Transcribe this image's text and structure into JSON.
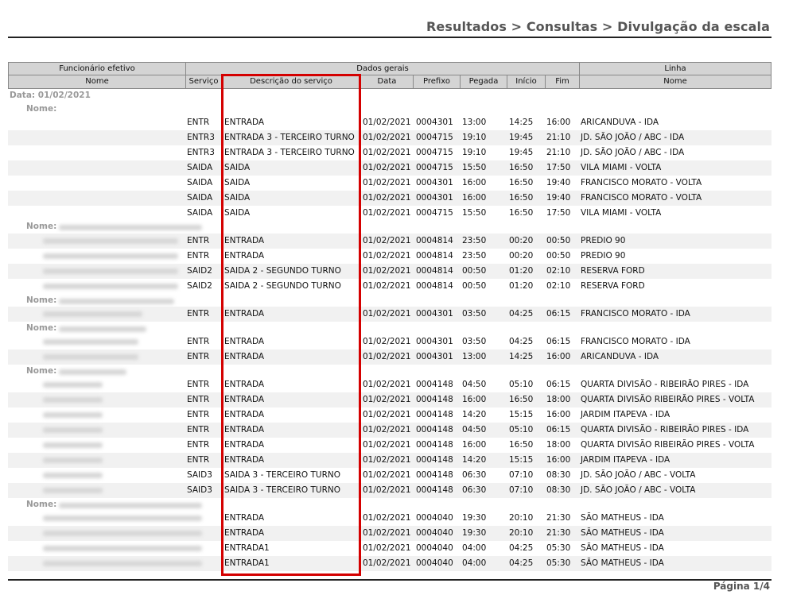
{
  "title": "Resultados > Consultas > Divulgação da escala",
  "footer": "Página 1/4",
  "headers": {
    "group1": "Funcionário efetivo",
    "group2": "Dados gerais",
    "group3": "Linha",
    "nome": "Nome",
    "servico": "Serviço",
    "descricao": "Descrição do serviço",
    "data": "Data",
    "prefixo": "Prefixo",
    "pegada": "Pegada",
    "inicio": "Início",
    "fim": "Fim",
    "linha_nome": "Nome"
  },
  "date_label": "Data: 01/02/2021",
  "nome_label": "Nome:",
  "rows": [
    {
      "srv": "ENTR",
      "desc": "ENTRADA",
      "data": "01/02/2021",
      "pref": "0004301",
      "peg": "13:00",
      "ini": "14:25",
      "fim": "16:00",
      "linha": "ARICANDUVA - IDA"
    },
    {
      "srv": "ENTR3",
      "desc": "ENTRADA 3 - TERCEIRO TURNO",
      "data": "01/02/2021",
      "pref": "0004715",
      "peg": "19:10",
      "ini": "19:45",
      "fim": "21:10",
      "linha": "JD. SÃO JOÃO / ABC - IDA"
    },
    {
      "srv": "ENTR3",
      "desc": "ENTRADA 3 - TERCEIRO TURNO",
      "data": "01/02/2021",
      "pref": "0004715",
      "peg": "19:10",
      "ini": "19:45",
      "fim": "21:10",
      "linha": "JD. SÃO JOÃO / ABC - IDA"
    },
    {
      "srv": "SAIDA",
      "desc": "SAIDA",
      "data": "01/02/2021",
      "pref": "0004715",
      "peg": "15:50",
      "ini": "16:50",
      "fim": "17:50",
      "linha": "VILA MIAMI - VOLTA"
    },
    {
      "srv": "SAIDA",
      "desc": "SAIDA",
      "data": "01/02/2021",
      "pref": "0004301",
      "peg": "16:00",
      "ini": "16:50",
      "fim": "19:40",
      "linha": "FRANCISCO MORATO - VOLTA"
    },
    {
      "srv": "SAIDA",
      "desc": "SAIDA",
      "data": "01/02/2021",
      "pref": "0004301",
      "peg": "16:00",
      "ini": "16:50",
      "fim": "19:40",
      "linha": "FRANCISCO MORATO - VOLTA"
    },
    {
      "srv": "SAIDA",
      "desc": "SAIDA",
      "data": "01/02/2021",
      "pref": "0004715",
      "peg": "15:50",
      "ini": "16:50",
      "fim": "17:50",
      "linha": "VILA MIAMI - VOLTA"
    },
    {
      "srv": "ENTR",
      "desc": "ENTRADA",
      "data": "01/02/2021",
      "pref": "0004814",
      "peg": "23:50",
      "ini": "00:20",
      "fim": "00:50",
      "linha": "PREDIO 90"
    },
    {
      "srv": "ENTR",
      "desc": "ENTRADA",
      "data": "01/02/2021",
      "pref": "0004814",
      "peg": "23:50",
      "ini": "00:20",
      "fim": "00:50",
      "linha": "PREDIO 90"
    },
    {
      "srv": "SAID2",
      "desc": "SAIDA 2 - SEGUNDO TURNO",
      "data": "01/02/2021",
      "pref": "0004814",
      "peg": "00:50",
      "ini": "01:20",
      "fim": "02:10",
      "linha": "RESERVA FORD"
    },
    {
      "srv": "SAID2",
      "desc": "SAIDA 2 - SEGUNDO TURNO",
      "data": "01/02/2021",
      "pref": "0004814",
      "peg": "00:50",
      "ini": "01:20",
      "fim": "02:10",
      "linha": "RESERVA FORD"
    },
    {
      "srv": "ENTR",
      "desc": "ENTRADA",
      "data": "01/02/2021",
      "pref": "0004301",
      "peg": "03:50",
      "ini": "04:25",
      "fim": "06:15",
      "linha": "FRANCISCO MORATO - IDA"
    },
    {
      "srv": "ENTR",
      "desc": "ENTRADA",
      "data": "01/02/2021",
      "pref": "0004301",
      "peg": "03:50",
      "ini": "04:25",
      "fim": "06:15",
      "linha": "FRANCISCO MORATO - IDA"
    },
    {
      "srv": "ENTR",
      "desc": "ENTRADA",
      "data": "01/02/2021",
      "pref": "0004301",
      "peg": "13:00",
      "ini": "14:25",
      "fim": "16:00",
      "linha": "ARICANDUVA - IDA"
    },
    {
      "srv": "ENTR",
      "desc": "ENTRADA",
      "data": "01/02/2021",
      "pref": "0004148",
      "peg": "04:50",
      "ini": "05:10",
      "fim": "06:15",
      "linha": "QUARTA DIVISÃO - RIBEIRÃO PIRES - IDA"
    },
    {
      "srv": "ENTR",
      "desc": "ENTRADA",
      "data": "01/02/2021",
      "pref": "0004148",
      "peg": "16:00",
      "ini": "16:50",
      "fim": "18:00",
      "linha": "QUARTA DIVISÃO RIBEIRÃO PIRES - VOLTA"
    },
    {
      "srv": "ENTR",
      "desc": "ENTRADA",
      "data": "01/02/2021",
      "pref": "0004148",
      "peg": "14:20",
      "ini": "15:15",
      "fim": "16:00",
      "linha": "JARDIM ITAPEVA - IDA"
    },
    {
      "srv": "ENTR",
      "desc": "ENTRADA",
      "data": "01/02/2021",
      "pref": "0004148",
      "peg": "04:50",
      "ini": "05:10",
      "fim": "06:15",
      "linha": "QUARTA DIVISÃO - RIBEIRÃO PIRES - IDA"
    },
    {
      "srv": "ENTR",
      "desc": "ENTRADA",
      "data": "01/02/2021",
      "pref": "0004148",
      "peg": "16:00",
      "ini": "16:50",
      "fim": "18:00",
      "linha": "QUARTA DIVISÃO RIBEIRÃO PIRES - VOLTA"
    },
    {
      "srv": "ENTR",
      "desc": "ENTRADA",
      "data": "01/02/2021",
      "pref": "0004148",
      "peg": "14:20",
      "ini": "15:15",
      "fim": "16:00",
      "linha": "JARDIM ITAPEVA - IDA"
    },
    {
      "srv": "SAID3",
      "desc": "SAIDA 3 - TERCEIRO TURNO",
      "data": "01/02/2021",
      "pref": "0004148",
      "peg": "06:30",
      "ini": "07:10",
      "fim": "08:30",
      "linha": "JD. SÃO JOÃO / ABC - VOLTA"
    },
    {
      "srv": "SAID3",
      "desc": "SAIDA 3 - TERCEIRO TURNO",
      "data": "01/02/2021",
      "pref": "0004148",
      "peg": "06:30",
      "ini": "07:10",
      "fim": "08:30",
      "linha": "JD. SÃO JOÃO / ABC - VOLTA"
    },
    {
      "srv": "",
      "desc": "ENTRADA",
      "data": "01/02/2021",
      "pref": "0004040",
      "peg": "19:30",
      "ini": "20:10",
      "fim": "21:30",
      "linha": "SÃO MATHEUS - IDA"
    },
    {
      "srv": "",
      "desc": "ENTRADA",
      "data": "01/02/2021",
      "pref": "0004040",
      "peg": "19:30",
      "ini": "20:10",
      "fim": "21:30",
      "linha": "SÃO MATHEUS - IDA"
    },
    {
      "srv": "",
      "desc": "ENTRADA1",
      "data": "01/02/2021",
      "pref": "0004040",
      "peg": "04:00",
      "ini": "04:25",
      "fim": "05:30",
      "linha": "SÃO MATHEUS - IDA"
    },
    {
      "srv": "",
      "desc": "ENTRADA1",
      "data": "01/02/2021",
      "pref": "0004040",
      "peg": "04:00",
      "ini": "04:25",
      "fim": "05:30",
      "linha": "SÃO MATHEUS - IDA"
    }
  ]
}
